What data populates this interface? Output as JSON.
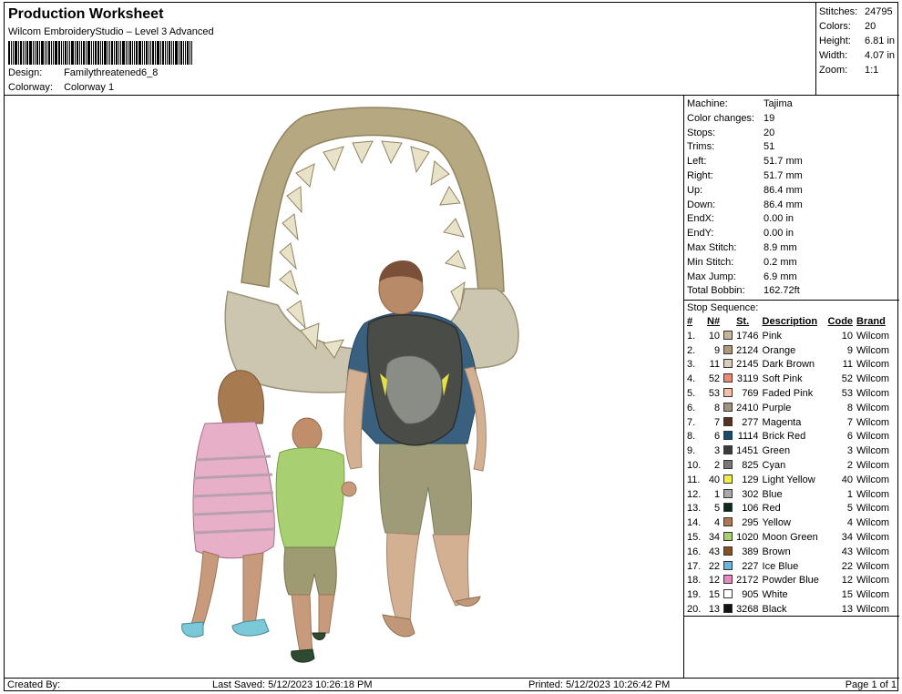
{
  "header": {
    "title": "Production Worksheet",
    "software": "Wilcom EmbroideryStudio – Level 3 Advanced",
    "design_label": "Design:",
    "design_value": "Familythreatened6_8",
    "colorway_label": "Colorway:",
    "colorway_value": "Colorway 1"
  },
  "stats": {
    "stitches_label": "Stitches:",
    "stitches": "24795",
    "colors_label": "Colors:",
    "colors": "20",
    "height_label": "Height:",
    "height": "6.81 in",
    "width_label": "Width:",
    "width": "4.07 in",
    "zoom_label": "Zoom:",
    "zoom": "1:1"
  },
  "machine": [
    {
      "k": "Machine:",
      "v": "Tajima"
    },
    {
      "k": "Color changes:",
      "v": "19"
    },
    {
      "k": "Stops:",
      "v": "20"
    },
    {
      "k": "Trims:",
      "v": "51"
    },
    {
      "k": "Left:",
      "v": "51.7 mm"
    },
    {
      "k": "Right:",
      "v": "51.7 mm"
    },
    {
      "k": "Up:",
      "v": "86.4 mm"
    },
    {
      "k": "Down:",
      "v": "86.4 mm"
    },
    {
      "k": "EndX:",
      "v": "0.00 in"
    },
    {
      "k": "EndY:",
      "v": "0.00 in"
    },
    {
      "k": "Max Stitch:",
      "v": "8.9 mm"
    },
    {
      "k": "Min Stitch:",
      "v": "0.2 mm"
    },
    {
      "k": "Max Jump:",
      "v": "6.9 mm"
    },
    {
      "k": "Total Bobbin:",
      "v": "162.72ft"
    }
  ],
  "stop_sequence": {
    "title": "Stop Sequence:",
    "headers": {
      "idx": "#",
      "n": "N#",
      "st": "St.",
      "desc": "Description",
      "code": "Code",
      "brand": "Brand"
    },
    "rows": [
      {
        "idx": "1.",
        "n": "10",
        "color": "#c8b49a",
        "st": "1746",
        "desc": "Pink",
        "code": "10",
        "brand": "Wilcom"
      },
      {
        "idx": "2.",
        "n": "9",
        "color": "#b09a76",
        "st": "2124",
        "desc": "Orange",
        "code": "9",
        "brand": "Wilcom"
      },
      {
        "idx": "3.",
        "n": "11",
        "color": "#d8cdb8",
        "st": "2145",
        "desc": "Dark Brown",
        "code": "11",
        "brand": "Wilcom"
      },
      {
        "idx": "4.",
        "n": "52",
        "color": "#f08878",
        "st": "3119",
        "desc": "Soft Pink",
        "code": "52",
        "brand": "Wilcom"
      },
      {
        "idx": "5.",
        "n": "53",
        "color": "#f4c0a8",
        "st": "769",
        "desc": "Faded Pink",
        "code": "53",
        "brand": "Wilcom"
      },
      {
        "idx": "6.",
        "n": "8",
        "color": "#a09480",
        "st": "2410",
        "desc": "Purple",
        "code": "8",
        "brand": "Wilcom"
      },
      {
        "idx": "7.",
        "n": "7",
        "color": "#5a3020",
        "st": "277",
        "desc": "Magenta",
        "code": "7",
        "brand": "Wilcom"
      },
      {
        "idx": "8.",
        "n": "6",
        "color": "#1a4a70",
        "st": "1114",
        "desc": "Brick Red",
        "code": "6",
        "brand": "Wilcom"
      },
      {
        "idx": "9.",
        "n": "3",
        "color": "#3a3c3a",
        "st": "1451",
        "desc": "Green",
        "code": "3",
        "brand": "Wilcom"
      },
      {
        "idx": "10.",
        "n": "2",
        "color": "#787878",
        "st": "825",
        "desc": "Cyan",
        "code": "2",
        "brand": "Wilcom"
      },
      {
        "idx": "11.",
        "n": "40",
        "color": "#f0f040",
        "st": "129",
        "desc": "Light Yellow",
        "code": "40",
        "brand": "Wilcom"
      },
      {
        "idx": "12.",
        "n": "1",
        "color": "#a8a8a8",
        "st": "302",
        "desc": "Blue",
        "code": "1",
        "brand": "Wilcom"
      },
      {
        "idx": "13.",
        "n": "5",
        "color": "#0e2a1c",
        "st": "106",
        "desc": "Red",
        "code": "5",
        "brand": "Wilcom"
      },
      {
        "idx": "14.",
        "n": "4",
        "color": "#b07850",
        "st": "295",
        "desc": "Yellow",
        "code": "4",
        "brand": "Wilcom"
      },
      {
        "idx": "15.",
        "n": "34",
        "color": "#a8d070",
        "st": "1020",
        "desc": "Moon Green",
        "code": "34",
        "brand": "Wilcom"
      },
      {
        "idx": "16.",
        "n": "43",
        "color": "#8a5020",
        "st": "389",
        "desc": "Brown",
        "code": "43",
        "brand": "Wilcom"
      },
      {
        "idx": "17.",
        "n": "22",
        "color": "#6ab4e0",
        "st": "227",
        "desc": "Ice Blue",
        "code": "22",
        "brand": "Wilcom"
      },
      {
        "idx": "18.",
        "n": "12",
        "color": "#e888c0",
        "st": "2172",
        "desc": "Powder Blue",
        "code": "12",
        "brand": "Wilcom"
      },
      {
        "idx": "19.",
        "n": "15",
        "color": "#ffffff",
        "st": "905",
        "desc": "White",
        "code": "15",
        "brand": "Wilcom"
      },
      {
        "idx": "20.",
        "n": "13",
        "color": "#111111",
        "st": "3268",
        "desc": "Black",
        "code": "13",
        "brand": "Wilcom"
      }
    ]
  },
  "footer": {
    "created_by": "Created By:",
    "last_saved": "Last Saved: 5/12/2023 10:26:18 PM",
    "printed": "Printed: 5/12/2023 10:26:42 PM",
    "page": "Page 1 of 1"
  }
}
